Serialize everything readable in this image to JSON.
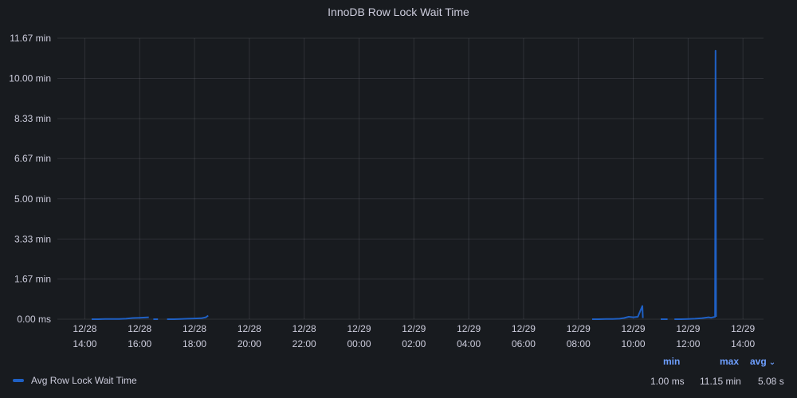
{
  "panel": {
    "title": "InnoDB Row Lock Wait Time"
  },
  "chart_data": {
    "type": "line",
    "title": "InnoDB Row Lock Wait Time",
    "ylim": [
      0,
      11.67
    ],
    "y_unit": "min",
    "ytick_labels": [
      "0.00 ms",
      "1.67 min",
      "3.33 min",
      "5.00 min",
      "6.67 min",
      "8.33 min",
      "10.00 min",
      "11.67 min"
    ],
    "ytick_values": [
      0,
      1.67,
      3.33,
      5.0,
      6.67,
      8.33,
      10.0,
      11.67
    ],
    "xlim": [
      "12/28 13:00",
      "12/29 14:45"
    ],
    "xticks": [
      {
        "t": "12/28 14:00",
        "date": "12/28",
        "time": "14:00"
      },
      {
        "t": "12/28 16:00",
        "date": "12/28",
        "time": "16:00"
      },
      {
        "t": "12/28 18:00",
        "date": "12/28",
        "time": "18:00"
      },
      {
        "t": "12/28 20:00",
        "date": "12/28",
        "time": "20:00"
      },
      {
        "t": "12/28 22:00",
        "date": "12/28",
        "time": "22:00"
      },
      {
        "t": "12/29 00:00",
        "date": "12/29",
        "time": "00:00"
      },
      {
        "t": "12/29 02:00",
        "date": "12/29",
        "time": "02:00"
      },
      {
        "t": "12/29 04:00",
        "date": "12/29",
        "time": "04:00"
      },
      {
        "t": "12/29 06:00",
        "date": "12/29",
        "time": "06:00"
      },
      {
        "t": "12/29 08:00",
        "date": "12/29",
        "time": "08:00"
      },
      {
        "t": "12/29 10:00",
        "date": "12/29",
        "time": "10:00"
      },
      {
        "t": "12/29 12:00",
        "date": "12/29",
        "time": "12:00"
      },
      {
        "t": "12/29 14:00",
        "date": "12/29",
        "time": "14:00"
      }
    ],
    "grid": true,
    "legend_position": "bottom",
    "series": [
      {
        "name": "Avg Row Lock Wait Time",
        "color": "#1f60c4",
        "segments": [
          [
            [
              "12/28 14:15",
              0.0
            ],
            [
              "12/28 14:30",
              0.0
            ],
            [
              "12/28 14:45",
              0.01
            ],
            [
              "12/28 15:00",
              0.01
            ],
            [
              "12/28 15:15",
              0.01
            ],
            [
              "12/28 15:30",
              0.02
            ],
            [
              "12/28 15:45",
              0.05
            ],
            [
              "12/28 16:00",
              0.06
            ],
            [
              "12/28 16:20",
              0.08
            ]
          ],
          [
            [
              "12/28 16:30",
              0.0
            ],
            [
              "12/28 16:40",
              0.0
            ]
          ],
          [
            [
              "12/28 17:00",
              0.0
            ],
            [
              "12/28 17:15",
              0.0
            ],
            [
              "12/28 17:30",
              0.01
            ],
            [
              "12/28 17:45",
              0.02
            ],
            [
              "12/28 18:00",
              0.03
            ],
            [
              "12/28 18:15",
              0.04
            ],
            [
              "12/28 18:25",
              0.08
            ],
            [
              "12/28 18:30",
              0.15
            ]
          ],
          [
            [
              "12/29 08:30",
              0.0
            ],
            [
              "12/29 08:45",
              0.0
            ],
            [
              "12/29 09:00",
              0.01
            ],
            [
              "12/29 09:15",
              0.01
            ],
            [
              "12/29 09:30",
              0.02
            ],
            [
              "12/29 09:40",
              0.05
            ],
            [
              "12/29 09:50",
              0.1
            ],
            [
              "12/29 10:00",
              0.08
            ],
            [
              "12/29 10:10",
              0.1
            ],
            [
              "12/29 10:20",
              0.55
            ],
            [
              "12/29 10:21",
              0.05
            ]
          ],
          [
            [
              "12/29 11:00",
              0.0
            ],
            [
              "12/29 11:15",
              0.0
            ]
          ],
          [
            [
              "12/29 11:30",
              0.0
            ],
            [
              "12/29 11:45",
              0.0
            ],
            [
              "12/29 12:00",
              0.01
            ],
            [
              "12/29 12:15",
              0.02
            ],
            [
              "12/29 12:30",
              0.04
            ],
            [
              "12/29 12:45",
              0.08
            ],
            [
              "12/29 12:50",
              0.06
            ],
            [
              "12/29 12:59",
              0.1
            ],
            [
              "12/29 13:00",
              11.15
            ],
            [
              "12/29 13:01",
              0.1
            ]
          ]
        ]
      }
    ]
  },
  "legend": {
    "items": [
      {
        "label": "Avg Row Lock Wait Time",
        "color": "#1f60c4"
      }
    ],
    "columns": {
      "min": "min",
      "max": "max",
      "avg": "avg"
    },
    "values": {
      "min": "1.00 ms",
      "max": "11.15 min",
      "avg": "5.08 s"
    }
  }
}
